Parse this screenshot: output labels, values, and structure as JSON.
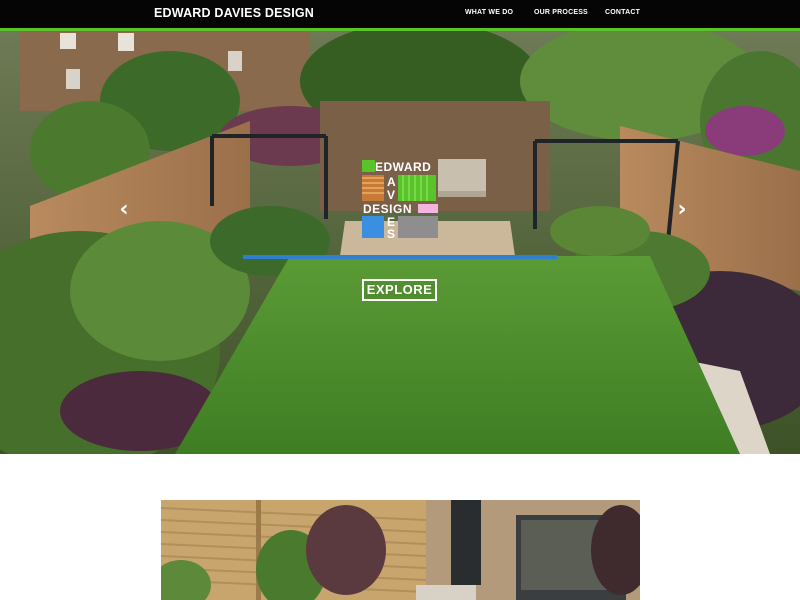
{
  "header": {
    "brand": "EDWARD DAVIES DESIGN",
    "nav": [
      {
        "label": "WHAT WE DO"
      },
      {
        "label": "OUR PROCESS"
      },
      {
        "label": "CONTACT"
      }
    ]
  },
  "hero": {
    "logo_lines": [
      "EDWARD",
      "A",
      "V",
      "DESIGN",
      "E",
      "S"
    ],
    "cta_label": "EXPLORE",
    "prev_arrow": "‹",
    "next_arrow": "›"
  },
  "colors": {
    "header_bg": "#050505",
    "accent_green": "#58c42a",
    "lawn_green": "#4f8a2d",
    "divider_blue": "#2f7fd0",
    "logo_pink": "#f4b4e0",
    "logo_blue": "#3a8fe0"
  }
}
